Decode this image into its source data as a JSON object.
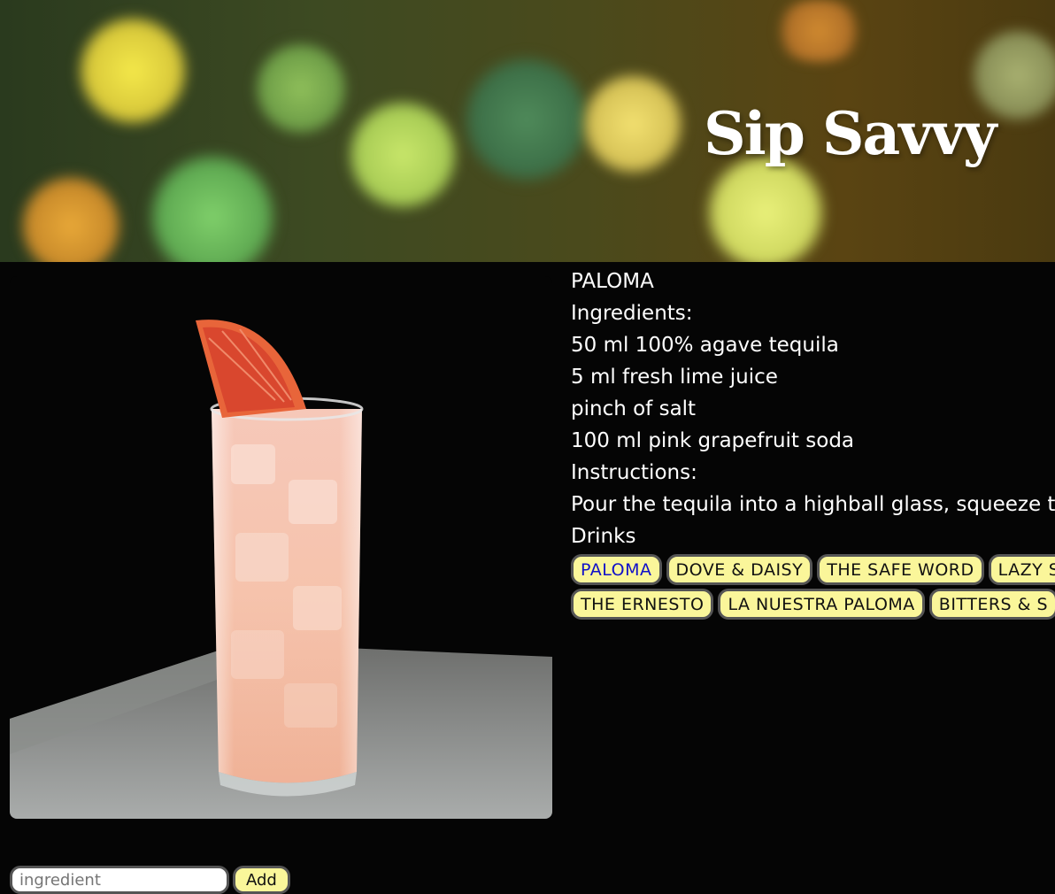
{
  "header": {
    "title": "Sip Savvy"
  },
  "drink": {
    "name": "PALOMA",
    "ingredients_label": "Ingredients:",
    "ingredients": [
      "50 ml 100% agave tequila",
      "5 ml fresh lime juice",
      "pinch of salt",
      "100 ml pink grapefruit soda"
    ],
    "instructions_label": "Instructions:",
    "instructions": "Pour the tequila into a highball glass, squeeze the li",
    "drinks_label": "Drinks"
  },
  "drink_chips": {
    "row1": [
      "PALOMA",
      "DOVE & DAISY",
      "THE SAFE WORD",
      "LAZY S"
    ],
    "row2": [
      "THE ERNESTO",
      "LA NUESTRA PALOMA",
      "BITTERS & S"
    ]
  },
  "form": {
    "input_placeholder": "ingredient",
    "add_label": "Add"
  },
  "colors": {
    "chip_bg": "#faf69a",
    "chip_active_text": "#1010c8",
    "background": "#050505"
  }
}
